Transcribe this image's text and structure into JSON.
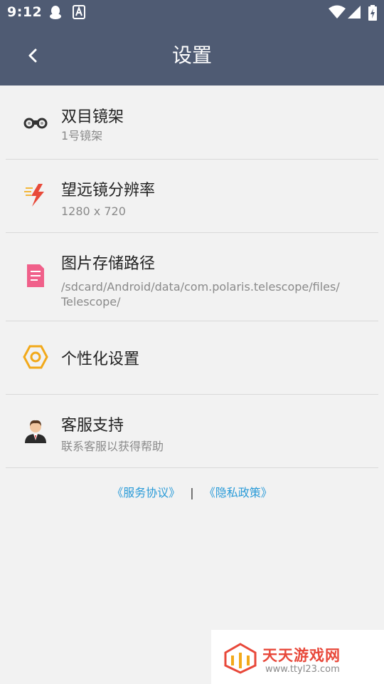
{
  "status_bar": {
    "time": "9:12",
    "icons": [
      "qq-icon",
      "a-notification-icon",
      "wifi-icon",
      "signal-icon",
      "battery-charging-icon"
    ]
  },
  "toolbar": {
    "title": "设置",
    "back_icon": "chevron-left-icon"
  },
  "settings": [
    {
      "title": "双目镜架",
      "subtitle": "1号镜架",
      "icon": "binoculars-icon"
    },
    {
      "title": "望远镜分辨率",
      "subtitle": "1280 x 720",
      "icon": "lightning-icon"
    },
    {
      "title": "图片存储路径",
      "subtitle_line1": "/sdcard/Android/data/com.polaris.telescope/files/",
      "subtitle_line2": "Telescope/",
      "icon": "document-icon"
    },
    {
      "title": "个性化设置",
      "icon": "hexagon-icon"
    },
    {
      "title": "客服支持",
      "subtitle": "联系客服以获得帮助",
      "icon": "support-agent-icon"
    }
  ],
  "footer": {
    "service_link": "《服务协议》",
    "separator": "|",
    "privacy_link": "《隐私政策》"
  },
  "watermark": {
    "title": "天天游戏网",
    "url": "www.ttyl23.com"
  },
  "colors": {
    "header": "#4f5b73",
    "background": "#f2f2f2",
    "link": "#2a9bd8"
  }
}
